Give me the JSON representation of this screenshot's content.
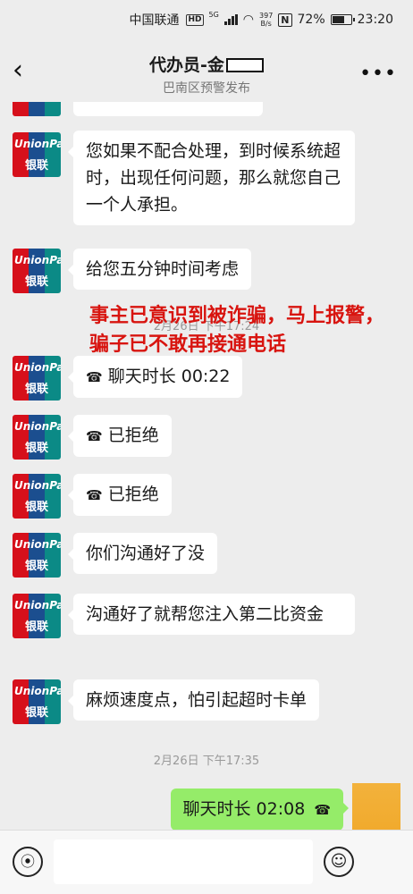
{
  "status_bar": {
    "carrier": "中国联通",
    "hd": "HD",
    "network": "5G",
    "speed_value": "397",
    "speed_unit": "B/s",
    "nfc": "N",
    "battery": "72%",
    "battery_level": 0.72,
    "time": "23:20"
  },
  "header": {
    "title": "代办员-金",
    "subtitle": "巴南区预警发布",
    "back_icon": "chevron-left-icon",
    "more_icon": "more-icon"
  },
  "contact": {
    "avatar_text_1": "UnionPay",
    "avatar_text_2": "银联"
  },
  "messages": [
    {
      "text": "您如果不配合处理，到时候系统超时，出现任何问题，那么就您自己一个人承担。"
    },
    {
      "text": "给您五分钟时间考虑"
    },
    {
      "text": "聊天时长 00:22",
      "icon": "phone-icon"
    },
    {
      "text": "已拒绝",
      "icon": "phone-icon"
    },
    {
      "text": "已拒绝",
      "icon": "phone-icon"
    },
    {
      "text": "你们沟通好了没"
    },
    {
      "text": "沟通好了就帮您注入第二比资金"
    },
    {
      "text": "麻烦速度点，怕引起超时卡单"
    }
  ],
  "timestamps": [
    "2月26日 下午17:24",
    "2月26日 下午17:35"
  ],
  "annotation": "事主已意识到被诈骗，马上报警，骗子已不敢再接通电话",
  "my_message": {
    "text": "聊天时长 02:08",
    "icon": "phone-icon"
  },
  "input_bar": {
    "voice_icon": "voice-icon",
    "emoji_icon": "emoji-icon"
  },
  "colors": {
    "overlay_text": "#d8140f",
    "my_bubble": "#95ec69",
    "background": "#ededed"
  }
}
